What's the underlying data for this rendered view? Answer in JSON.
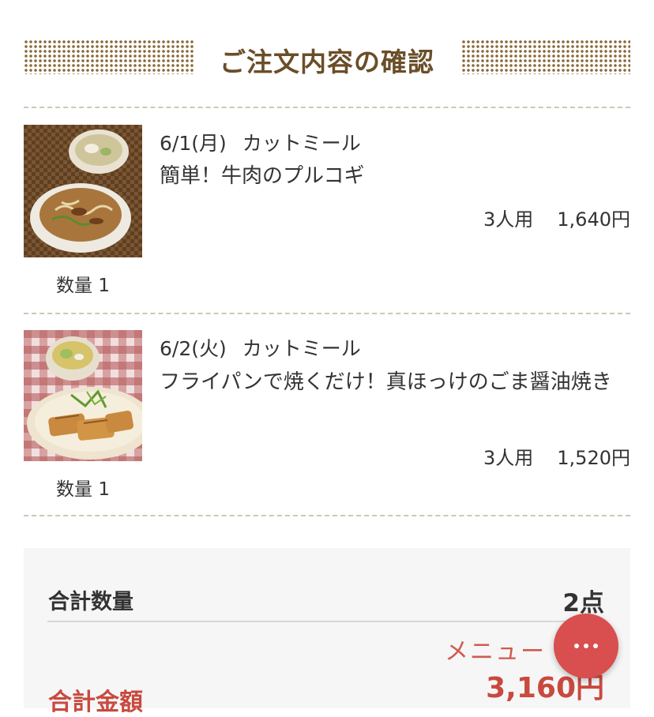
{
  "page_title": "ご注文内容の確認",
  "items": [
    {
      "date": "6/1(月)",
      "type": "カットミール",
      "name": "簡単！牛肉のプルコギ",
      "servings": "3人用",
      "price": "1,640円",
      "quantity": "数量 1"
    },
    {
      "date": "6/2(火)",
      "type": "カットミール",
      "name": "フライパンで焼くだけ！真ほっけのごま醤油焼き",
      "servings": "3人用",
      "price": "1,520円",
      "quantity": "数量 1"
    }
  ],
  "summary": {
    "total_qty_label": "合計数量",
    "total_qty_value": "2点",
    "total_amount_label": "合計金額",
    "total_amount_value": "3,160円"
  },
  "menu_button": {
    "label": "メニュー",
    "icon": "more-horizontal-icon"
  },
  "colors": {
    "title_brown": "#6a4e28",
    "accent_red": "#c9493f",
    "fab_red": "#d94e4e"
  }
}
